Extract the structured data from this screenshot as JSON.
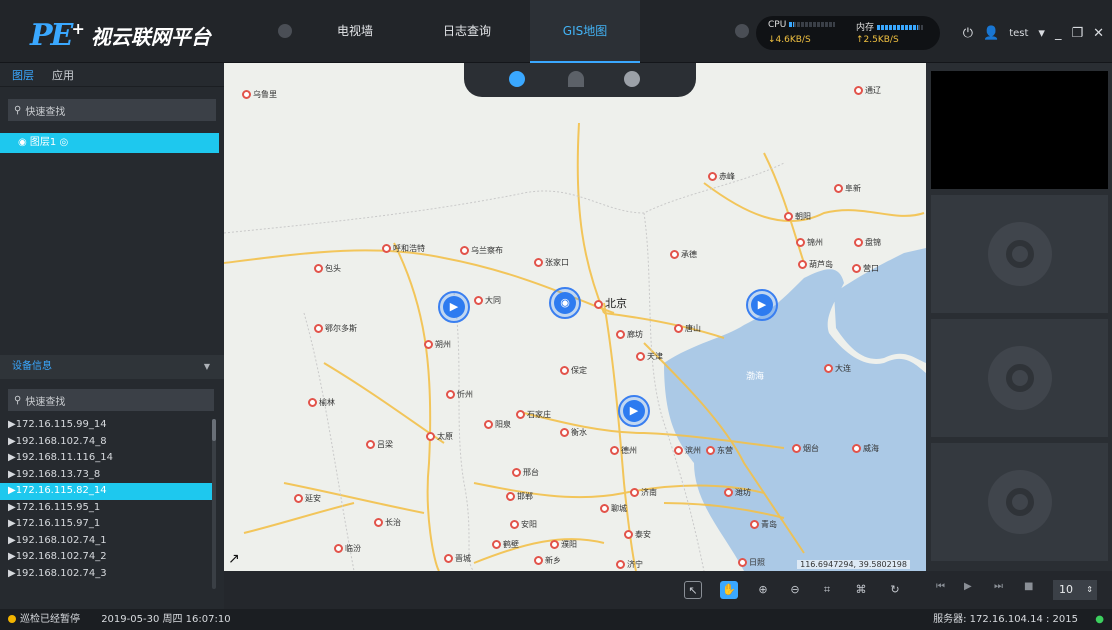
{
  "app": {
    "logo_mark": "PE",
    "logo_plus": "+",
    "logo_text": "视云联网平台"
  },
  "nav": {
    "tabs": [
      {
        "label": "电视墙"
      },
      {
        "label": "日志查询"
      },
      {
        "label": "GIS地图"
      }
    ],
    "active_index": 2
  },
  "stats": {
    "cpu_label": "CPU",
    "mem_label": "内存",
    "cpu_level": 0.1,
    "mem_level": 0.9,
    "down_rate": "↓4.6KB/S",
    "up_rate": "↑2.5KB/S"
  },
  "user": {
    "name": "test"
  },
  "left": {
    "tabs": [
      {
        "label": "图层"
      },
      {
        "label": "应用"
      }
    ],
    "search_placeholder": "快速查找",
    "layer_item": "图层1",
    "device_header": "设备信息",
    "device_search_placeholder": "快速查找",
    "devices": [
      "172.16.115.99_14",
      "192.168.102.74_8",
      "192.168.11.116_14",
      "192.168.13.73_8",
      "172.16.115.82_14",
      "172.16.115.95_1",
      "172.16.115.97_1",
      "192.168.102.74_1",
      "192.168.102.74_2",
      "192.168.102.74_3"
    ],
    "selected_device": 4
  },
  "map": {
    "cities": [
      "乌鲁里",
      "通辽",
      "赤峰",
      "阜新",
      "朝阳",
      "锦州",
      "盘锦",
      "葫芦岛",
      "营口",
      "呼和浩特",
      "乌兰察布",
      "张家口",
      "承德",
      "包头",
      "大同",
      "北京",
      "鄂尔多斯",
      "廊坊",
      "唐山",
      "朔州",
      "天津",
      "保定",
      "大连",
      "忻州",
      "榆林",
      "石家庄",
      "衡水",
      "太原",
      "阳泉",
      "吕梁",
      "德州",
      "滨州",
      "东营",
      "烟台",
      "威海",
      "邢台",
      "邯郸",
      "济南",
      "潍坊",
      "延安",
      "长治",
      "安阳",
      "聊城",
      "泰安",
      "临汾",
      "鹤壁",
      "濮阳",
      "青岛",
      "日照",
      "晋城",
      "新乡",
      "济宁"
    ],
    "sea_label": "渤海",
    "coords": "116.6947294, 39.5802198",
    "arrow_glyph": "↗"
  },
  "bottom_toolbar": {
    "page_size": "10"
  },
  "status": {
    "patrol": "巡检已经暂停",
    "datetime": "2019-05-30 周四 16:07:10",
    "server": "服务器: 172.16.104.14 : 2015"
  },
  "colors": {
    "accent": "#3aa8ff",
    "selection": "#1ec8ee",
    "camera": "#2d7bf0"
  }
}
